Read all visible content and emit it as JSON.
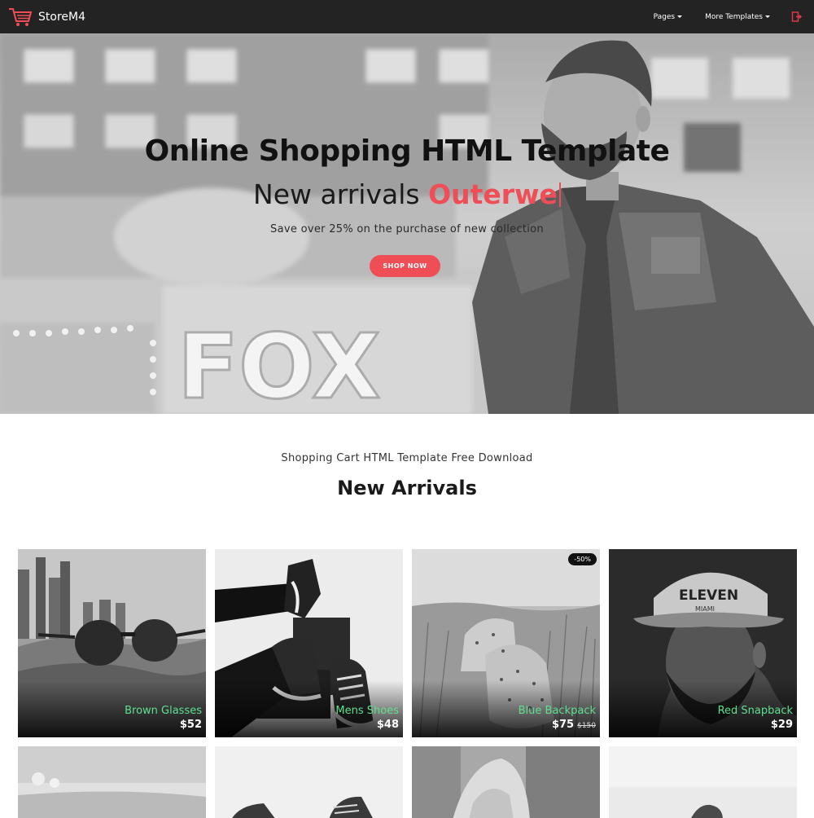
{
  "navbar": {
    "brand": "StoreM4",
    "pages_label": "Pages",
    "more_label": "More Templates"
  },
  "hero": {
    "title": "Online Shopping HTML Template",
    "subtitle_prefix": "New arrivals",
    "subtitle_accent": "Outerwe",
    "description": "Save over 25% on the purchase of new collection",
    "button": "SHOP NOW",
    "sign_text": "FOX"
  },
  "section": {
    "subtitle": "Shopping Cart HTML Template Free Download",
    "title": "New Arrivals"
  },
  "products": [
    {
      "name": "Brown Glasses",
      "price": "$52"
    },
    {
      "name": "Mens Shoes",
      "price": "$48"
    },
    {
      "name": "Blue Backpack",
      "price": "$75",
      "old_price": "$150",
      "badge": "-50%"
    },
    {
      "name": "Red Snapback",
      "price": "$29",
      "cap_text": "ELEVEN",
      "cap_sub": "MIAMI"
    }
  ],
  "colors": {
    "accent": "#f04e56",
    "product_name": "#5ee08f",
    "navbar": "#232323"
  }
}
